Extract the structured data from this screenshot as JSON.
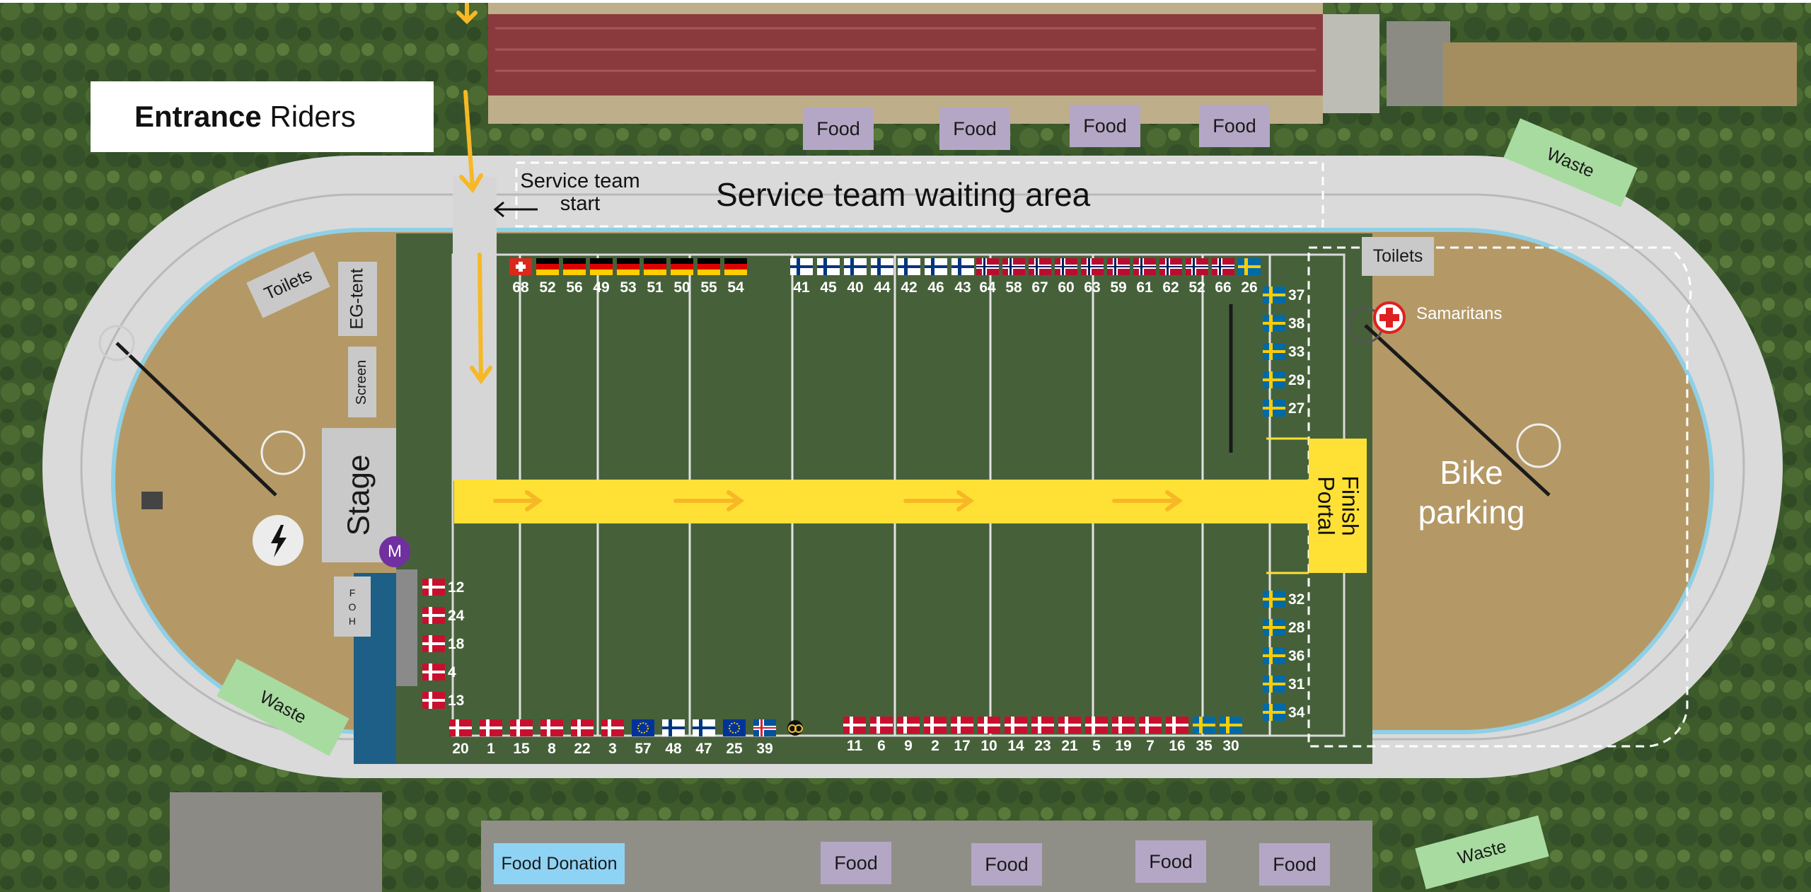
{
  "entrance": {
    "bold": "Entrance",
    "rest": " Riders"
  },
  "service_team_start": {
    "line1": "Service team",
    "line2": "start"
  },
  "service_team_waiting": "Service team waiting area",
  "food_label": "Food",
  "food_donation": "Food Donation",
  "waste_label": "Waste",
  "toilets_label": "Toilets",
  "eg_tent": "EG-tent",
  "screen": "Screen",
  "stage": "Stage",
  "foh": "F\nO\nH",
  "marker_m": "M",
  "samaritans": "Samaritans",
  "bike_parking": {
    "line1": "Bike",
    "line2": "parking"
  },
  "finish_portal": "Finish\nPortal",
  "icons": {
    "power": "lightning-bolt-icon",
    "first_aid": "red-cross-icon",
    "arrow": "arrow-icon"
  },
  "colors": {
    "yellow": "#ffe135",
    "arrow": "#f7b825",
    "food": "#b4a7c6",
    "waste": "#a8dba0",
    "donation": "#8fd3f4",
    "foh": "#1d5f86",
    "marker": "#7030a0"
  },
  "flags_top": [
    {
      "c": "ch",
      "n": "68"
    },
    {
      "c": "de",
      "n": "52"
    },
    {
      "c": "de",
      "n": "56"
    },
    {
      "c": "de",
      "n": "49"
    },
    {
      "c": "de",
      "n": "53"
    },
    {
      "c": "de",
      "n": "51"
    },
    {
      "c": "de",
      "n": "50"
    },
    {
      "c": "de",
      "n": "55"
    },
    {
      "c": "de",
      "n": "54"
    },
    {
      "c": "fi",
      "n": "41"
    },
    {
      "c": "fi",
      "n": "45"
    },
    {
      "c": "fi",
      "n": "40"
    },
    {
      "c": "fi",
      "n": "44"
    },
    {
      "c": "fi",
      "n": "42"
    },
    {
      "c": "fi",
      "n": "46"
    },
    {
      "c": "fi",
      "n": "43"
    },
    {
      "c": "no",
      "n": "64"
    },
    {
      "c": "no",
      "n": "58"
    },
    {
      "c": "no",
      "n": "67"
    },
    {
      "c": "no",
      "n": "60"
    },
    {
      "c": "no",
      "n": "63"
    },
    {
      "c": "no",
      "n": "59"
    },
    {
      "c": "no",
      "n": "61"
    },
    {
      "c": "no",
      "n": "62"
    },
    {
      "c": "no",
      "n": "52"
    },
    {
      "c": "no",
      "n": "66"
    },
    {
      "c": "se",
      "n": "26"
    }
  ],
  "flags_right_top": [
    {
      "c": "se",
      "n": "37"
    },
    {
      "c": "se",
      "n": "38"
    },
    {
      "c": "se",
      "n": "33"
    },
    {
      "c": "se",
      "n": "29"
    },
    {
      "c": "se",
      "n": "27"
    }
  ],
  "flags_right_bottom": [
    {
      "c": "se",
      "n": "32"
    },
    {
      "c": "se",
      "n": "28"
    },
    {
      "c": "se",
      "n": "36"
    },
    {
      "c": "se",
      "n": "31"
    },
    {
      "c": "se",
      "n": "34"
    }
  ],
  "flags_left": [
    {
      "c": "dk",
      "n": "12"
    },
    {
      "c": "dk",
      "n": "24"
    },
    {
      "c": "dk",
      "n": "18"
    },
    {
      "c": "dk",
      "n": "4"
    },
    {
      "c": "dk",
      "n": "13"
    }
  ],
  "flags_bottom_left": [
    {
      "c": "dk",
      "n": "20"
    },
    {
      "c": "dk",
      "n": "1"
    },
    {
      "c": "dk",
      "n": "15"
    },
    {
      "c": "dk",
      "n": "8"
    },
    {
      "c": "dk",
      "n": "22"
    },
    {
      "c": "dk",
      "n": "3"
    },
    {
      "c": "eu",
      "n": "57"
    },
    {
      "c": "fi",
      "n": "48"
    },
    {
      "c": "fi",
      "n": "47"
    },
    {
      "c": "eu",
      "n": "25"
    },
    {
      "c": "is",
      "n": "39"
    },
    {
      "c": "ucc",
      "n": ""
    }
  ],
  "flags_bottom_right": [
    {
      "c": "dk",
      "n": "11"
    },
    {
      "c": "dk",
      "n": "6"
    },
    {
      "c": "dk",
      "n": "9"
    },
    {
      "c": "dk",
      "n": "2"
    },
    {
      "c": "dk",
      "n": "17"
    },
    {
      "c": "dk",
      "n": "10"
    },
    {
      "c": "dk",
      "n": "14"
    },
    {
      "c": "dk",
      "n": "23"
    },
    {
      "c": "dk",
      "n": "21"
    },
    {
      "c": "dk",
      "n": "5"
    },
    {
      "c": "dk",
      "n": "19"
    },
    {
      "c": "dk",
      "n": "7"
    },
    {
      "c": "dk",
      "n": "16"
    },
    {
      "c": "se",
      "n": "35"
    },
    {
      "c": "se",
      "n": "30"
    }
  ]
}
